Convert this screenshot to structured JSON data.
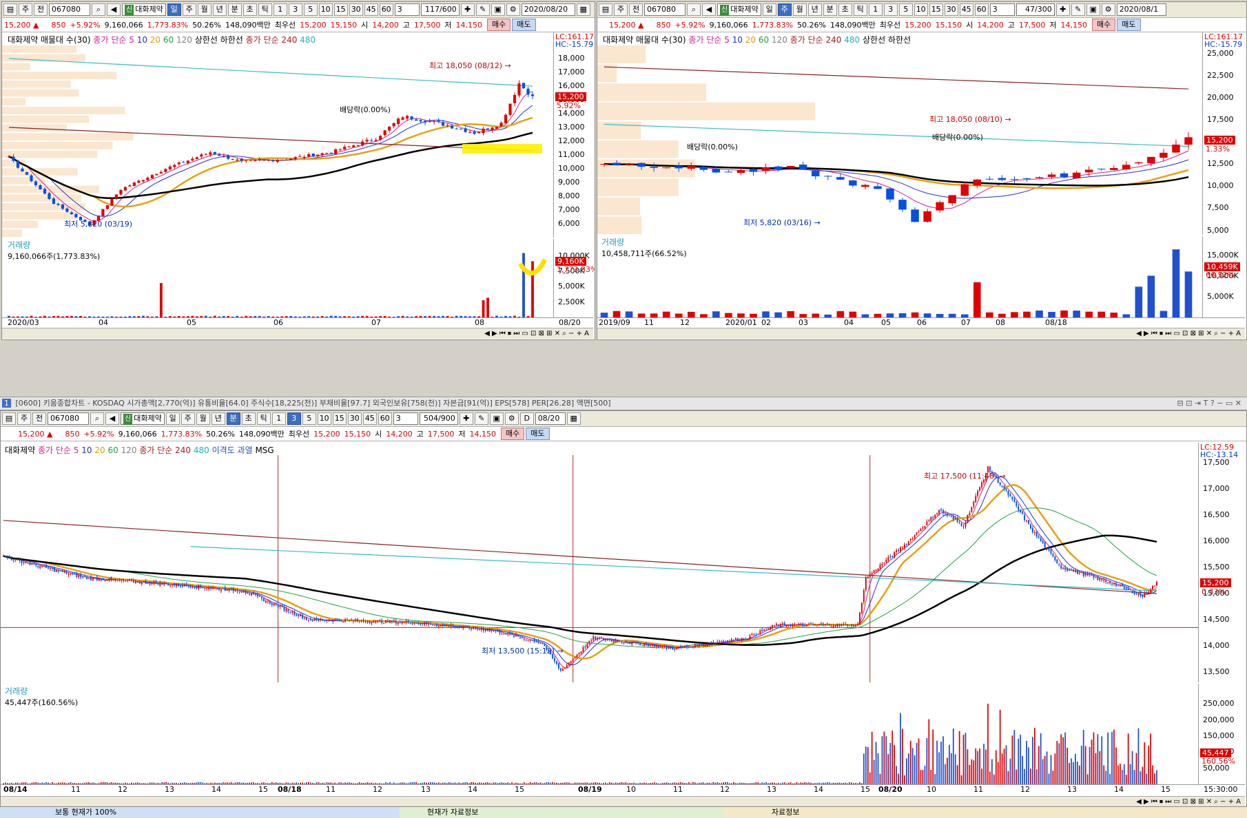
{
  "top_left": {
    "toolbar": {
      "kind_a": "주",
      "kind_b": "전",
      "code": "067080",
      "stock_tag": "신",
      "stock_name": "대화제약",
      "periods": [
        "일",
        "주",
        "월",
        "년",
        "분",
        "초",
        "틱"
      ],
      "selected_period": "일",
      "nums": [
        "1",
        "3",
        "5",
        "10",
        "15",
        "30",
        "45",
        "60"
      ],
      "count_num": "3",
      "bar_count": "117",
      "bar_max": "/600",
      "date": "2020/08/20"
    },
    "quote": {
      "price": "15,200",
      "arrow": "▲",
      "change": "850",
      "pct": "+5.92%",
      "volume": "9,160,066",
      "vol_ratio": "1,773.83%",
      "turnover": "50.26%",
      "amount": "148,090백만",
      "best_ask_label": "최우선",
      "ask": "15,200",
      "bid": "15,150",
      "open_label": "시",
      "open": "14,200",
      "high_label": "고",
      "high": "17,500",
      "low_label": "저",
      "low": "14,150",
      "buy": "매수",
      "sell": "매도"
    },
    "legend": {
      "profile": "대화제약 매물대 수(30)",
      "ma": "종가 단순 5",
      "ma2": "10",
      "ma3": "20",
      "ma4": "60",
      "ma5": "120",
      "limit": "상한선 하한선",
      "ma240": "종가 단순 240",
      "ma480": "480"
    },
    "lc": "LC:161.17",
    "hc": "HC:-15.79",
    "price_label": "15,200",
    "pct_label": "5.92%",
    "high_ann": "최고 18,050 (08/12) →",
    "low_ann": "최저 5,820 (03/19)",
    "div_ann": "배당락(0.00%)",
    "vol_title": "거래량",
    "vol_sub": "9,160,066주(1,773.83%)",
    "vol_label": "9,160K",
    "vol_pct": "1,773.83%"
  },
  "top_right": {
    "toolbar": {
      "kind_a": "주",
      "kind_b": "전",
      "code": "067080",
      "stock_tag": "신",
      "stock_name": "대화제약",
      "periods": [
        "일",
        "주",
        "월",
        "년",
        "분",
        "초",
        "틱"
      ],
      "selected_period": "주",
      "nums": [
        "1",
        "3",
        "5",
        "10",
        "15",
        "30",
        "45",
        "60"
      ],
      "count_num": "3",
      "bar_count": "47",
      "bar_max": "/300",
      "date": "2020/08/1"
    },
    "quote": {
      "price": "15,200",
      "arrow": "▲",
      "change": "850",
      "pct": "+5.92%",
      "volume": "9,160,066",
      "vol_ratio": "1,773.83%",
      "turnover": "50.26%",
      "amount": "148,090백만",
      "best_ask_label": "최우선",
      "ask": "15,200",
      "bid": "15,150",
      "open_label": "시",
      "open": "14,200",
      "high_label": "고",
      "high": "17,500",
      "low_label": "저",
      "low": "14,150",
      "buy": "매수",
      "sell": "매도"
    },
    "legend": {
      "profile": "대화제약 매물대 수(30)",
      "ma": "종가 단순 5",
      "ma2": "10",
      "ma3": "20",
      "ma4": "60",
      "ma5": "120",
      "ma240": "종가 단순 240",
      "ma480": "480",
      "limit": "상한선 하한선"
    },
    "lc": "LC:161.17",
    "hc": "HC:-15.79",
    "price_label": "15,200",
    "pct_label": "1.33%",
    "high_ann": "최고 18,050 (08/10) →",
    "low_ann": "최저 5,820 (03/16) →",
    "div_ann": "배당락(0.00%)",
    "div_ann2": "배당락(0.00%)",
    "vol_title": "거래량",
    "vol_sub": "10,458,711주(66.52%)",
    "vol_label": "10,459K",
    "vol_pct": "66.52%"
  },
  "bottom": {
    "caption": "[0600] 키움종합차트 - KOSDAQ 시가총액[2,770(억)] 유통비율[64.0] 주식수[18,225(천)] 부채비율[97.7] 외국인보유[758(천)] 자본금[91(억)] EPS[578] PER[26.28] 액면[500]",
    "caption_num": "1",
    "toolbar": {
      "kind_a": "주",
      "kind_b": "전",
      "code": "067080",
      "stock_tag": "신",
      "stock_name": "대화제약",
      "periods": [
        "일",
        "주",
        "월",
        "년",
        "분",
        "초",
        "틱"
      ],
      "selected_period": "분",
      "nums": [
        "1",
        "3",
        "5",
        "10",
        "15",
        "30",
        "45",
        "60"
      ],
      "selected_num": "3",
      "count_num": "3",
      "bar_count": "504",
      "bar_max": "/900",
      "d_label": "D",
      "date": "08/20"
    },
    "quote": {
      "price": "15,200",
      "arrow": "▲",
      "change": "850",
      "pct": "+5.92%",
      "volume": "9,160,066",
      "vol_ratio": "1,773.83%",
      "turnover": "50.26%",
      "amount": "148,090백만",
      "best_ask_label": "최우선",
      "ask": "15,200",
      "bid": "15,150",
      "open_label": "시",
      "open": "14,200",
      "high_label": "고",
      "high": "17,500",
      "low_label": "저",
      "low": "14,150",
      "buy": "매수",
      "sell": "매도"
    },
    "legend": {
      "name": "대화제약",
      "ma": "종가 단순 5",
      "ma2": "10",
      "ma3": "20",
      "ma4": "60",
      "ma5": "120",
      "ma240": "종가 단순 240",
      "ma480": "480",
      "disp": "이격도 과열",
      "msg": "MSG"
    },
    "lc": "LC:12.59",
    "hc": "HC:-13.14",
    "price_label": "15,200",
    "pct_label": "0.33%",
    "high_ann": "최고 17,500 (11:48) →",
    "low_ann": "최저 13,500 (15:12) →",
    "vol_title": "거래량",
    "vol_sub": "45,447주(160.56%)",
    "vol_label": "45,447",
    "vol_pct": "160.56%",
    "time_label": "15:30:00"
  },
  "status": {
    "s1": "보통 현재가 100%",
    "s2": "현재가 자료정보",
    "s3": "자료정보"
  },
  "chart_data": [
    {
      "type": "candlestick",
      "id": "daily",
      "title": "",
      "y_ticks": [
        6000,
        7000,
        8000,
        9000,
        10000,
        11000,
        12000,
        13000,
        14000,
        15000,
        16000,
        17000,
        18000
      ],
      "ylim": [
        5000,
        19000
      ],
      "x_ticks": [
        "2020/03",
        "04",
        "05",
        "06",
        "07",
        "08",
        "08/20"
      ],
      "anchors": [
        {
          "x": 0,
          "y": 10800
        },
        {
          "x": 10,
          "y": 7500
        },
        {
          "x": 18,
          "y": 5900
        },
        {
          "x": 25,
          "y": 8500
        },
        {
          "x": 35,
          "y": 10000
        },
        {
          "x": 45,
          "y": 11200
        },
        {
          "x": 52,
          "y": 10500
        },
        {
          "x": 62,
          "y": 10700
        },
        {
          "x": 72,
          "y": 11200
        },
        {
          "x": 82,
          "y": 12200
        },
        {
          "x": 88,
          "y": 13800
        },
        {
          "x": 96,
          "y": 13300
        },
        {
          "x": 104,
          "y": 12600
        },
        {
          "x": 110,
          "y": 13300
        },
        {
          "x": 114,
          "y": 16200
        },
        {
          "x": 117,
          "y": 15200
        }
      ],
      "key_points": {
        "high": 18050,
        "low": 5820,
        "last": 15200
      },
      "volume": {
        "y_ticks": [
          "2,500K",
          "5,000K",
          "7,500K",
          "10,000K"
        ],
        "ylim": [
          0,
          11000000
        ],
        "spikes": [
          {
            "x": 34,
            "v": 5600000
          },
          {
            "x": 106,
            "v": 2800000
          },
          {
            "x": 107,
            "v": 3200000
          },
          {
            "x": 115,
            "v": 10500000
          },
          {
            "x": 117,
            "v": 9160066
          }
        ]
      }
    },
    {
      "type": "candlestick",
      "id": "weekly",
      "title": "",
      "y_ticks": [
        5000,
        7500,
        10000,
        12500,
        15000,
        17500,
        20000,
        22500,
        25000
      ],
      "ylim": [
        4500,
        26000
      ],
      "x_ticks": [
        "2019/09",
        "11",
        "12",
        "2020/01",
        "02",
        "03",
        "04",
        "05",
        "06",
        "07",
        "08",
        "08/18"
      ],
      "anchors": [
        {
          "x": 0,
          "y": 12600
        },
        {
          "x": 5,
          "y": 12300
        },
        {
          "x": 10,
          "y": 11600
        },
        {
          "x": 15,
          "y": 12000
        },
        {
          "x": 18,
          "y": 11000
        },
        {
          "x": 22,
          "y": 9600
        },
        {
          "x": 25,
          "y": 6000
        },
        {
          "x": 27,
          "y": 8300
        },
        {
          "x": 30,
          "y": 10900
        },
        {
          "x": 35,
          "y": 10800
        },
        {
          "x": 40,
          "y": 12100
        },
        {
          "x": 43,
          "y": 12600
        },
        {
          "x": 45,
          "y": 14000
        },
        {
          "x": 47,
          "y": 15200
        }
      ],
      "key_points": {
        "high": 18050,
        "low": 5820,
        "last": 15200
      },
      "volume": {
        "y_ticks": [
          "5,000K",
          "10,000K",
          "15,000K"
        ],
        "ylim": [
          0,
          16000000
        ],
        "spikes": [
          {
            "x": 30,
            "v": 8000000
          },
          {
            "x": 43,
            "v": 7000000
          },
          {
            "x": 44,
            "v": 9500000
          },
          {
            "x": 46,
            "v": 15500000
          },
          {
            "x": 47,
            "v": 10458711
          }
        ]
      }
    },
    {
      "type": "candlestick",
      "id": "minute3",
      "title": "",
      "y_ticks": [
        13500,
        14000,
        14500,
        15000,
        15500,
        16000,
        16500,
        17000,
        17500
      ],
      "ylim": [
        13300,
        17650
      ],
      "x_ticks": [
        "08/14",
        "11",
        "12",
        "13",
        "14",
        "15",
        "08/18",
        "11",
        "12",
        "13",
        "14",
        "15",
        "08/19",
        "10",
        "11",
        "12",
        "13",
        "14",
        "15",
        "08/20",
        "10",
        "11",
        "12",
        "13",
        "14",
        "15",
        "15:30:00"
      ],
      "anchors": [
        {
          "x": 0,
          "y": 15700
        },
        {
          "x": 40,
          "y": 15300
        },
        {
          "x": 90,
          "y": 15150
        },
        {
          "x": 118,
          "y": 15050
        },
        {
          "x": 150,
          "y": 14500
        },
        {
          "x": 200,
          "y": 14450
        },
        {
          "x": 240,
          "y": 14300
        },
        {
          "x": 265,
          "y": 14050
        },
        {
          "x": 274,
          "y": 13520
        },
        {
          "x": 290,
          "y": 14150
        },
        {
          "x": 330,
          "y": 13950
        },
        {
          "x": 365,
          "y": 14150
        },
        {
          "x": 380,
          "y": 14400
        },
        {
          "x": 420,
          "y": 14400
        },
        {
          "x": 424,
          "y": 15300
        },
        {
          "x": 445,
          "y": 16000
        },
        {
          "x": 460,
          "y": 16600
        },
        {
          "x": 472,
          "y": 16300
        },
        {
          "x": 484,
          "y": 17400
        },
        {
          "x": 494,
          "y": 16900
        },
        {
          "x": 506,
          "y": 16200
        },
        {
          "x": 520,
          "y": 15500
        },
        {
          "x": 545,
          "y": 15200
        },
        {
          "x": 560,
          "y": 14950
        },
        {
          "x": 567,
          "y": 15200
        }
      ],
      "key_points": {
        "high": 17500,
        "low": 13500,
        "last": 15200
      },
      "volume": {
        "y_ticks": [
          "50,000",
          "100,000",
          "150,000",
          "200,000",
          "250,000"
        ],
        "ylim": [
          0,
          280000
        ],
        "spikes": [
          {
            "x": 425,
            "v": 120000
          },
          {
            "x": 433,
            "v": 170000
          },
          {
            "x": 441,
            "v": 230000
          },
          {
            "x": 455,
            "v": 210000
          },
          {
            "x": 467,
            "v": 180000
          },
          {
            "x": 484,
            "v": 260000
          },
          {
            "x": 490,
            "v": 240000
          },
          {
            "x": 500,
            "v": 160000
          },
          {
            "x": 518,
            "v": 140000
          },
          {
            "x": 567,
            "v": 45447
          }
        ]
      }
    }
  ]
}
